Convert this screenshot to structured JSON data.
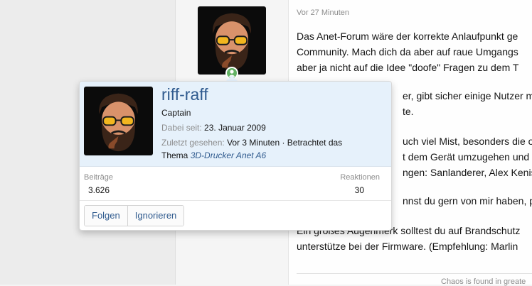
{
  "post": {
    "time": "Vor 27 Minuten",
    "lines": [
      "Das Anet-Forum wäre der korrekte Anlaufpunkt ge",
      "Community. Mach dich da aber auf raue Umgangs",
      "aber ja nicht auf die Idee \"doofe\" Fragen zu dem T",
      "er, gibt sicher einige Nutzer mit",
      "te.",
      "uch viel Mist, besonders die oft",
      "t dem Gerät umzugehen und die",
      "ngen: Sanlanderer, Alex Kenis, C",
      "nnst du gern von mir haben, pe",
      "Ein großes Augenmerk solltest du auf Brandschutz",
      "unterstütze bei der Firmware. (Empfehlung: Marlin"
    ],
    "signature": "Chaos is found in greate"
  },
  "member_tooltip": {
    "username": "riff-raff",
    "user_title": "Captain",
    "joined_label": "Dabei seit:",
    "joined_value": "23. Januar 2009",
    "last_seen_label": "Zuletzt gesehen:",
    "last_seen_value": "Vor 3 Minuten · Betrachtet das",
    "thema_label": "Thema",
    "thema_link": "3D-Drucker Anet A6",
    "stats": {
      "posts_label": "Beiträge",
      "posts_value": "3.626",
      "reactions_label": "Reaktionen",
      "reactions_value": "30"
    },
    "buttons": {
      "follow": "Folgen",
      "ignore": "Ignorieren"
    }
  },
  "colors": {
    "accent": "#2f5a8e",
    "tooltip_header": "#e6f1fb",
    "online": "#63b265"
  }
}
